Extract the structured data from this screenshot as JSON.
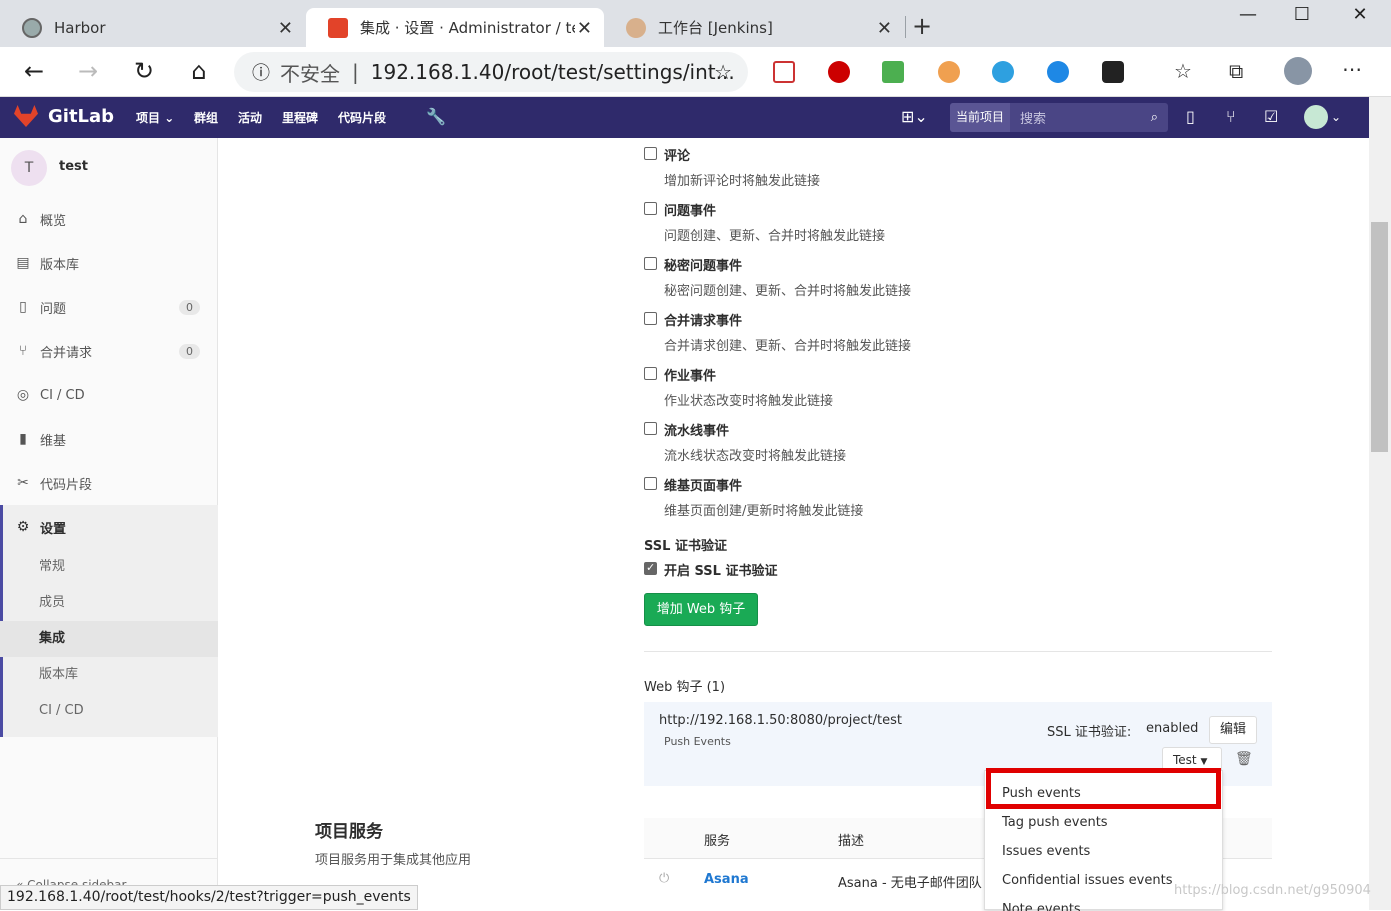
{
  "browser": {
    "tabs": [
      {
        "title": "Harbor"
      },
      {
        "title": "集成 · 设置 · Administrator / test"
      },
      {
        "title": "工作台 [Jenkins]"
      }
    ],
    "address": {
      "security": "不安全",
      "url": "192.168.1.40/root/test/settings/int..."
    }
  },
  "gitlab": {
    "brand": "GitLab",
    "nav": [
      "项目",
      "群组",
      "活动",
      "里程碑",
      "代码片段"
    ],
    "search_scope": "当前项目",
    "search_placeholder": "搜索"
  },
  "sidebar": {
    "project_initial": "T",
    "project_name": "test",
    "items": [
      {
        "label": "概览"
      },
      {
        "label": "版本库"
      },
      {
        "label": "问题",
        "count": "0"
      },
      {
        "label": "合并请求",
        "count": "0"
      },
      {
        "label": "CI / CD"
      },
      {
        "label": "维基"
      },
      {
        "label": "代码片段"
      },
      {
        "label": "设置"
      }
    ],
    "settings_sub": [
      "常规",
      "成员",
      "集成",
      "版本库",
      "CI / CD"
    ],
    "collapse": "Collapse sidebar"
  },
  "triggers": [
    {
      "label": "评论",
      "hint": "增加新评论时将触发此链接"
    },
    {
      "label": "问题事件",
      "hint": "问题创建、更新、合并时将触发此链接"
    },
    {
      "label": "秘密问题事件",
      "hint": "秘密问题创建、更新、合并时将触发此链接"
    },
    {
      "label": "合并请求事件",
      "hint": "合并请求创建、更新、合并时将触发此链接"
    },
    {
      "label": "作业事件",
      "hint": "作业状态改变时将触发此链接"
    },
    {
      "label": "流水线事件",
      "hint": "流水线状态改变时将触发此链接"
    },
    {
      "label": "维基页面事件",
      "hint": "维基页面创建/更新时将触发此链接"
    }
  ],
  "ssl": {
    "heading": "SSL 证书验证",
    "checkbox": "开启 SSL 证书验证"
  },
  "add_button": "增加 Web 钩子",
  "webhooks": {
    "heading": "Web 钩子 (1)",
    "url": "http://192.168.1.50:8080/project/test",
    "events": "Push Events",
    "ssl_label": "SSL 证书验证:",
    "ssl_value": "enabled",
    "edit": "编辑",
    "test": "Test"
  },
  "dropdown": [
    "Push events",
    "Tag push events",
    "Issues events",
    "Confidential issues events",
    "Note events"
  ],
  "services": {
    "title": "项目服务",
    "desc": "项目服务用于集成其他应用",
    "col_service": "服务",
    "col_desc": "描述",
    "rows": [
      {
        "name": "Asana",
        "desc": "Asana - 无电子邮件团队"
      }
    ]
  },
  "status_bar": "192.168.1.40/root/test/hooks/2/test?trigger=push_events",
  "watermark": "https://blog.csdn.net/g950904",
  "colors": {
    "gitlab_header": "#2f2a6b",
    "green": "#1aaa55",
    "highlight": "#e00000"
  }
}
